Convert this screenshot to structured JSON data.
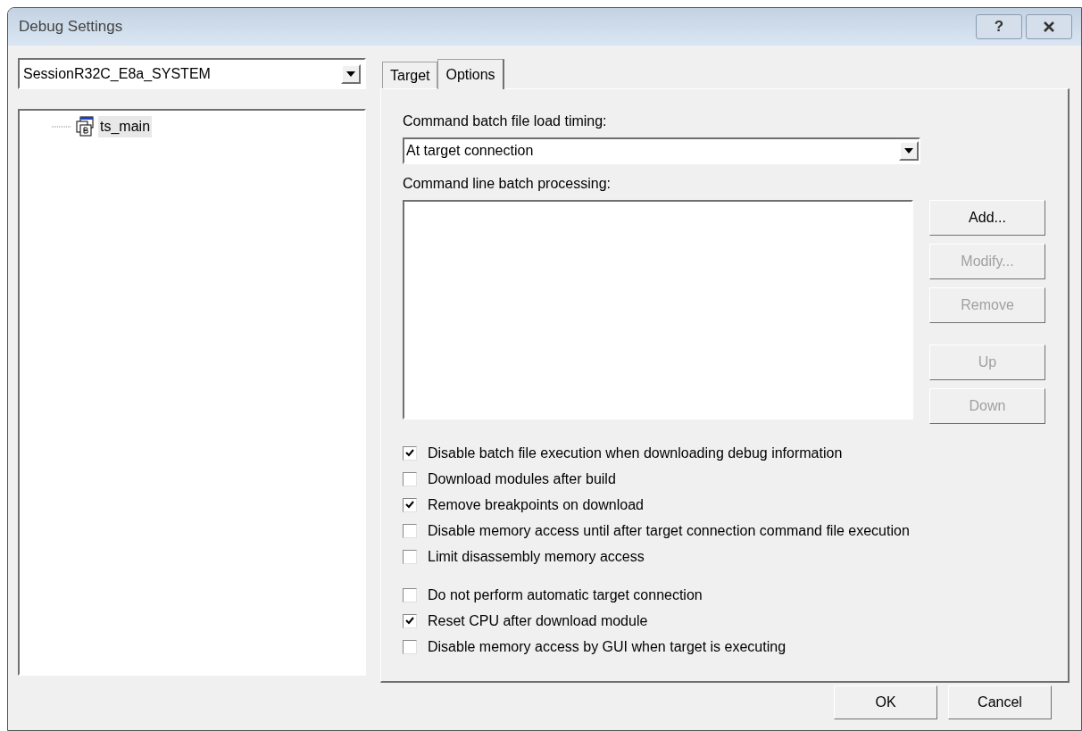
{
  "window": {
    "title": "Debug Settings",
    "help_button": "?"
  },
  "session": {
    "value": "SessionR32C_E8a_SYSTEM"
  },
  "tree": {
    "items": [
      {
        "label": "ts_main",
        "selected": true
      }
    ]
  },
  "tabs": [
    {
      "label": "Target",
      "selected": false
    },
    {
      "label": "Options",
      "selected": true
    }
  ],
  "options": {
    "timing_label": "Command batch file load timing:",
    "timing": {
      "value": "At target connection"
    },
    "batch_label": "Command line batch processing:",
    "side_buttons": [
      [
        {
          "label": "Add...",
          "disabled": false
        },
        {
          "label": "Modify...",
          "disabled": true
        },
        {
          "label": "Remove",
          "disabled": true
        }
      ],
      [
        {
          "label": "Up",
          "disabled": true
        },
        {
          "label": "Down",
          "disabled": true
        }
      ]
    ],
    "checkbox_groups": [
      [
        {
          "label": "Disable batch file execution when downloading debug information",
          "checked": true
        },
        {
          "label": "Download modules after build",
          "checked": false
        },
        {
          "label": "Remove breakpoints on download",
          "checked": true
        },
        {
          "label": "Disable memory access until after target connection command file execution",
          "checked": false
        },
        {
          "label": "Limit disassembly memory access",
          "checked": false
        }
      ],
      [
        {
          "label": "Do not perform automatic target connection",
          "checked": false
        },
        {
          "label": "Reset CPU after download module",
          "checked": true
        },
        {
          "label": "Disable memory access by GUI when target is executing",
          "checked": false
        }
      ]
    ]
  },
  "buttons": [
    "OK",
    "Cancel"
  ]
}
